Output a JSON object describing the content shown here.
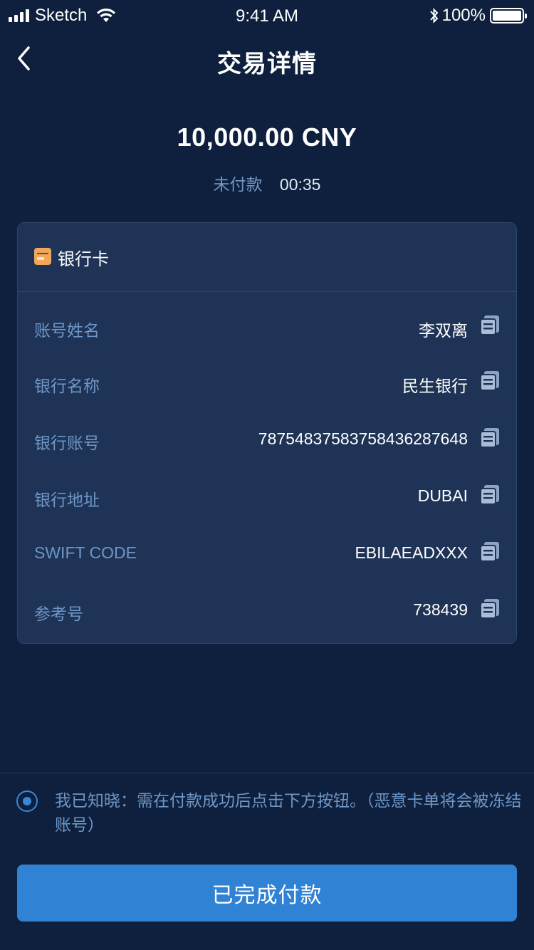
{
  "status_bar": {
    "carrier": "Sketch",
    "time": "9:41 AM",
    "battery": "100%",
    "bluetooth_icon": "bluetooth-icon",
    "wifi_icon": "wifi-icon"
  },
  "nav": {
    "title": "交易详情",
    "back_icon": "chevron-left-icon"
  },
  "amount": "10,000.00 CNY",
  "payment_status": {
    "label": "未付款",
    "countdown": "00:35"
  },
  "card": {
    "title": "银行卡",
    "icon": "bank-card-icon",
    "rows": [
      {
        "label": "账号姓名",
        "value": "李双离"
      },
      {
        "label": "银行名称",
        "value": "民生银行"
      },
      {
        "label": "银行账号",
        "value": "7875483758375843628764​8"
      },
      {
        "label": "银行地址",
        "value": "DUBAI"
      },
      {
        "label": "SWIFT CODE",
        "value": "EBILAEADXXX"
      },
      {
        "label": "参考号",
        "value": "738439"
      }
    ],
    "copy_icon": "copy-icon"
  },
  "notice": "我已知晓：需在付款成功后点击下方按钮。（恶意卡单将会被冻结账号）",
  "confirm_button": "已完成付款",
  "colors": {
    "background": "#0e203d",
    "card": "#1e3356",
    "label": "#6e96c7",
    "accent": "#2f82d4"
  }
}
